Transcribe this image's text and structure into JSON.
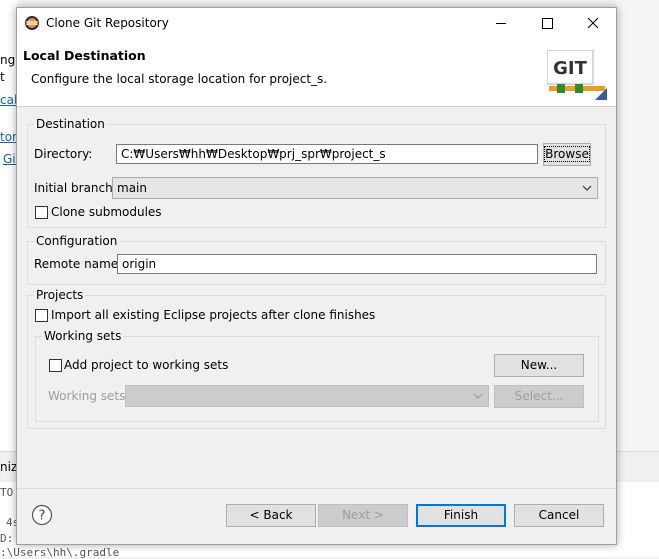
{
  "background": {
    "left_fragments": [
      "ng",
      "t",
      "cal",
      "tory",
      "Git"
    ],
    "tab_fragment": "niz",
    "console_lines": [
      "TO",
      "4s",
      "D:",
      ":\\Users\\hh\\.gradle"
    ]
  },
  "dialog": {
    "title": "Clone Git Repository",
    "header": {
      "title": "Local Destination",
      "description": "Configure the local storage location for project_s.",
      "logo_text": "GIT"
    },
    "destination": {
      "group_label": "Destination",
      "directory_label": "Directory:",
      "directory_value": "C:₩Users₩hh₩Desktop₩prj_spr₩project_s",
      "browse_label": "Browse",
      "initial_branch_label": "Initial branch:",
      "initial_branch_value": "main",
      "clone_submodules_label": "Clone submodules",
      "clone_submodules_checked": false
    },
    "configuration": {
      "group_label": "Configuration",
      "remote_name_label": "Remote name:",
      "remote_name_value": "origin"
    },
    "projects": {
      "group_label": "Projects",
      "import_label": "Import all existing Eclipse projects after clone finishes",
      "import_checked": false,
      "working_sets": {
        "group_label": "Working sets",
        "add_label": "Add project to working sets",
        "add_checked": false,
        "new_label": "New...",
        "working_sets_label": "Working sets:",
        "working_sets_value": "",
        "select_label": "Select..."
      }
    },
    "buttons": {
      "back": "< Back",
      "next": "Next >",
      "finish": "Finish",
      "cancel": "Cancel"
    }
  },
  "colors": {
    "accent": "#0078d7",
    "link": "#1a5fb4",
    "disabled_text": "#9d9d9d"
  }
}
